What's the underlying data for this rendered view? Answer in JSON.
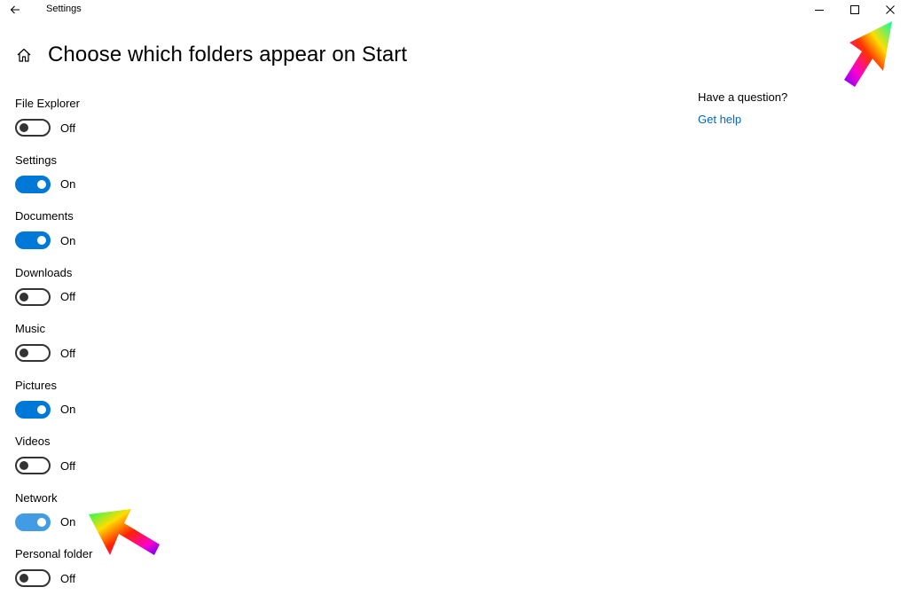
{
  "window": {
    "title": "Settings",
    "back_icon": "arrow-left-icon",
    "minimize_icon": "minimize-icon",
    "maximize_icon": "maximize-icon",
    "close_icon": "close-icon"
  },
  "page": {
    "home_icon": "home-icon",
    "title": "Choose which folders appear on Start"
  },
  "colors": {
    "accent": "#0078d7",
    "accent_hover": "#429ce3",
    "link": "#0067c0",
    "toggle_off": "#333333"
  },
  "folders": [
    {
      "label": "File Explorer",
      "state": "Off"
    },
    {
      "label": "Settings",
      "state": "On"
    },
    {
      "label": "Documents",
      "state": "On"
    },
    {
      "label": "Downloads",
      "state": "Off"
    },
    {
      "label": "Music",
      "state": "Off"
    },
    {
      "label": "Pictures",
      "state": "On"
    },
    {
      "label": "Videos",
      "state": "Off"
    },
    {
      "label": "Network",
      "state": "On"
    },
    {
      "label": "Personal folder",
      "state": "Off"
    }
  ],
  "help": {
    "title": "Have a question?",
    "link": "Get help"
  }
}
